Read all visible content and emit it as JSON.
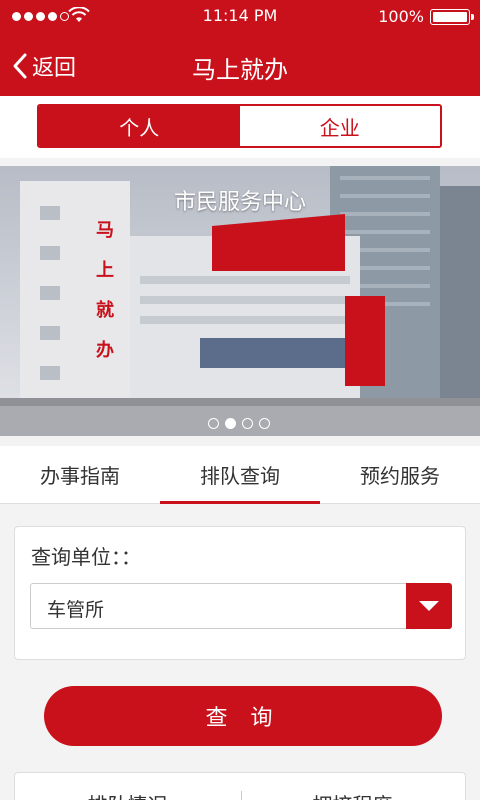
{
  "status_bar": {
    "time": "11:14 PM",
    "battery": "100%"
  },
  "nav": {
    "back_label": "返回",
    "title": "马上就办"
  },
  "segment": {
    "personal": "个人",
    "business": "企业"
  },
  "banner": {
    "caption": "市民服务中心",
    "slide_count": 4,
    "active_slide_index": 1
  },
  "tabs": {
    "guide": "办事指南",
    "queue": "排队查询",
    "appointment": "预约服务"
  },
  "query_form": {
    "label": "查询单位：：",
    "selected_unit": "车管所",
    "submit_label": "查 询"
  },
  "bottom": {
    "left": "排队情况",
    "right": "拥挤程度"
  },
  "colors": {
    "brand_red": "#c9111c"
  }
}
